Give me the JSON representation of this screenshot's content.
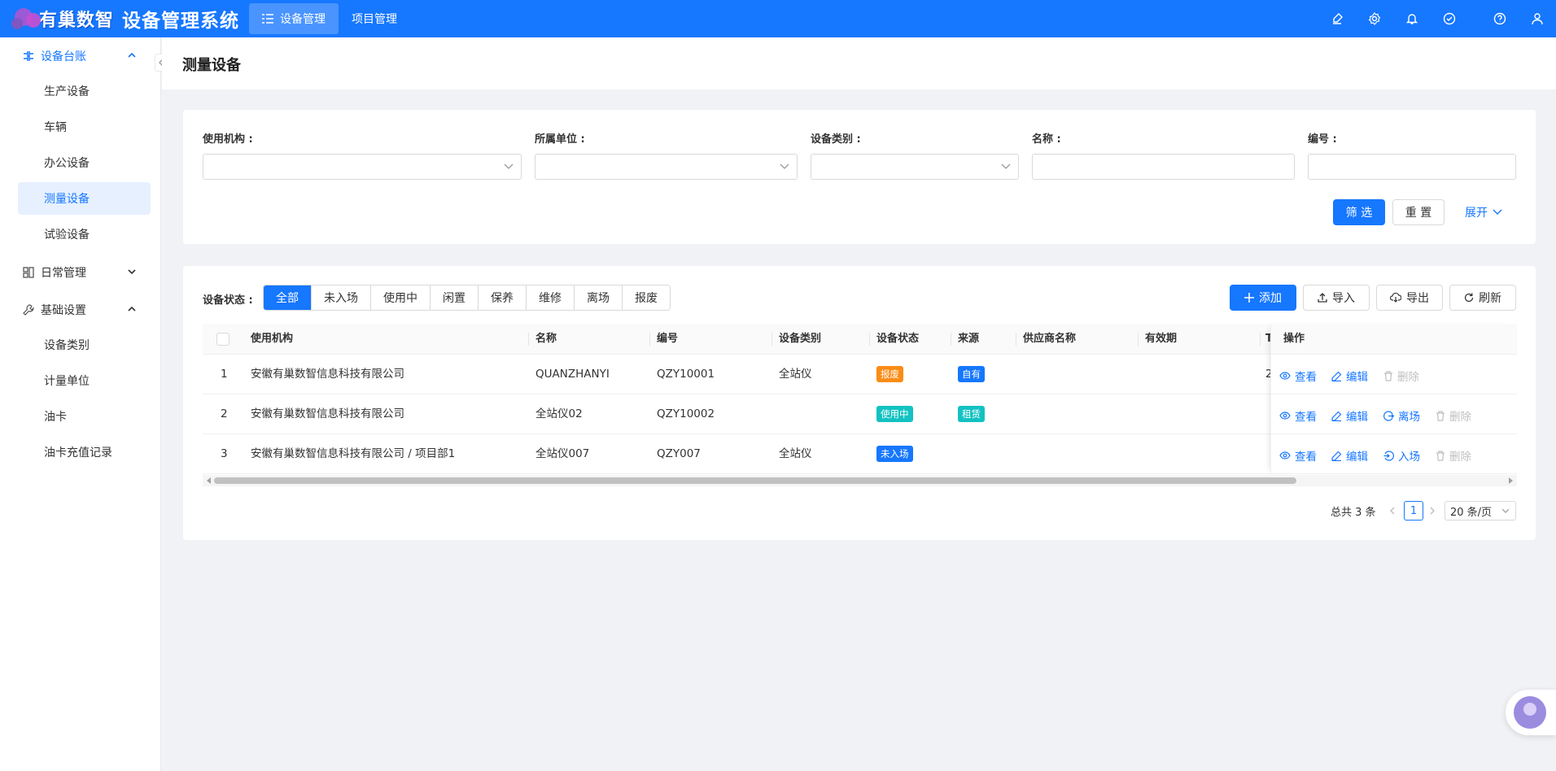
{
  "header": {
    "logo_text": "有巢数智",
    "app_title": "设备管理系统",
    "nav": [
      {
        "label": "设备管理",
        "active": true
      },
      {
        "label": "项目管理",
        "active": false
      }
    ],
    "tools": [
      "brush-icon",
      "gear-icon",
      "bell-icon",
      "check-circle-icon",
      "help-icon",
      "user-icon"
    ]
  },
  "sidebar": {
    "groups": [
      {
        "label": "设备台账",
        "open": true,
        "items": [
          "生产设备",
          "车辆",
          "办公设备",
          "测量设备",
          "试验设备"
        ],
        "active_item": "测量设备"
      },
      {
        "label": "日常管理",
        "open": false,
        "items": []
      },
      {
        "label": "基础设置",
        "open": true,
        "items": [
          "设备类别",
          "计量单位",
          "油卡",
          "油卡充值记录"
        ]
      }
    ]
  },
  "page": {
    "title": "测量设备"
  },
  "filters": {
    "org_label": "使用机构 :",
    "unit_label": "所属单位 :",
    "category_label": "设备类别 :",
    "name_label": "名称 :",
    "code_label": "编号 :",
    "org_value": "",
    "unit_value": "",
    "category_value": "",
    "name_value": "",
    "code_value": "",
    "filter_btn": "筛 选",
    "reset_btn": "重 置",
    "expand_btn": "展开"
  },
  "toolbar": {
    "status_label": "设备状态 :",
    "statuses": [
      "全部",
      "未入场",
      "使用中",
      "闲置",
      "保养",
      "维修",
      "离场",
      "报废"
    ],
    "active_status": "全部",
    "add": "添加",
    "import": "导入",
    "export": "导出",
    "refresh": "刷新"
  },
  "table": {
    "columns": [
      "使用机构",
      "名称",
      "编号",
      "设备类别",
      "设备状态",
      "来源",
      "供应商名称",
      "有效期",
      "T",
      "操作"
    ],
    "rows": [
      {
        "index": "1",
        "org": "安徽有巢数智信息科技有限公司",
        "name": "QUANZHANYI",
        "code": "QZY10001",
        "category": "全站仪",
        "status": "报废",
        "status_color": "#fa8c16",
        "source": "自有",
        "source_color": "#1677ff",
        "supplier": "",
        "valid": "",
        "extra": "2",
        "ops": [
          "查看",
          "编辑",
          "删除"
        ]
      },
      {
        "index": "2",
        "org": "安徽有巢数智信息科技有限公司",
        "name": "全站仪02",
        "code": "QZY10002",
        "category": "",
        "status": "使用中",
        "status_color": "#13c2c2",
        "source": "租赁",
        "source_color": "#13c2c2",
        "supplier": "",
        "valid": "",
        "extra": "",
        "ops": [
          "查看",
          "编辑",
          "离场",
          "删除"
        ]
      },
      {
        "index": "3",
        "org": "安徽有巢数智信息科技有限公司 / 项目部1",
        "name": "全站仪007",
        "code": "QZY007",
        "category": "全站仪",
        "status": "未入场",
        "status_color": "#1677ff",
        "source": "",
        "source_color": "",
        "supplier": "",
        "valid": "",
        "extra": "",
        "ops": [
          "查看",
          "编辑",
          "入场",
          "删除"
        ]
      }
    ]
  },
  "pagination": {
    "total": "总共 3 条",
    "current": "1",
    "page_size": "20 条/页"
  },
  "colors": {
    "primary": "#1677ff",
    "header_bg": "#1677ff",
    "page_bg": "#f0f2f5"
  }
}
